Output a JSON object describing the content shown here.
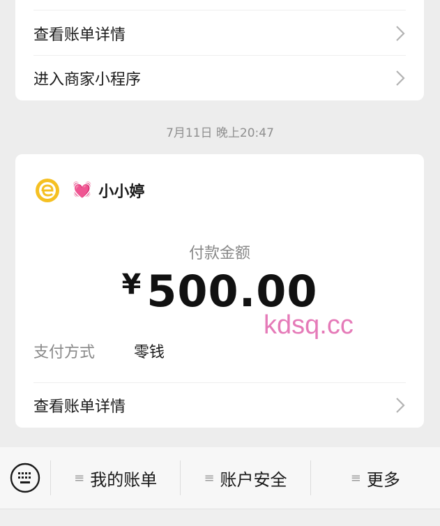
{
  "top_card": {
    "view_bill_label": "查看账单详情",
    "mini_program_label": "进入商家小程序"
  },
  "timestamp": "7月11日 晚上20:47",
  "payment_card": {
    "merchant_name": "小小婷",
    "heart_icon": "💓",
    "amount_label": "付款金额",
    "currency_symbol": "¥",
    "amount": "500.00",
    "watermark": "kdsq.cc",
    "payment_method_label": "支付方式",
    "payment_method_value": "零钱",
    "view_bill_label": "查看账单详情"
  },
  "bottom_menu": {
    "items": [
      {
        "label": "我的账单"
      },
      {
        "label": "账户安全"
      },
      {
        "label": "更多"
      }
    ],
    "menu_glyph": "≡"
  },
  "colors": {
    "background": "#ededed",
    "watermark": "#e57ab8",
    "logo_yellow": "#f5c022"
  }
}
